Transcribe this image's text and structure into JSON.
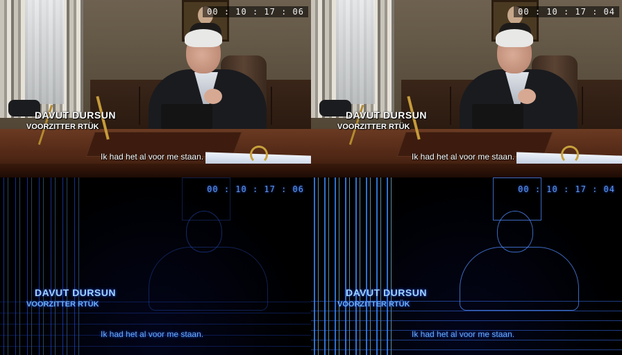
{
  "frames": [
    {
      "id": "top-left",
      "timecode": "00 : 10 : 17 : 06",
      "caption_name": "DAVUT DURSUN",
      "caption_role": "VOORZITTER RTÜK",
      "subtitle": "Ik had het al voor me staan."
    },
    {
      "id": "top-right",
      "timecode": "00 : 10 : 17 : 04",
      "caption_name": "DAVUT DURSUN",
      "caption_role": "VOORZITTER RTÜK",
      "subtitle": "Ik had het al voor me staan."
    },
    {
      "id": "bottom-left",
      "timecode": "00 : 10 : 17 : 06",
      "caption_name": "DAVUT DURSUN",
      "caption_role": "VOORZITTER RTÜK",
      "subtitle": "Ik had het al voor me staan."
    },
    {
      "id": "bottom-right",
      "timecode": "00 : 10 : 17 : 04",
      "caption_name": "DAVUT DURSUN",
      "caption_role": "VOORZITTER RTÜK",
      "subtitle": "Ik had het al voor me staan."
    }
  ],
  "colors": {
    "edge_blue": "#1b5cff",
    "desk_wood": "#6b3a22",
    "caption_white": "#ffffff"
  }
}
